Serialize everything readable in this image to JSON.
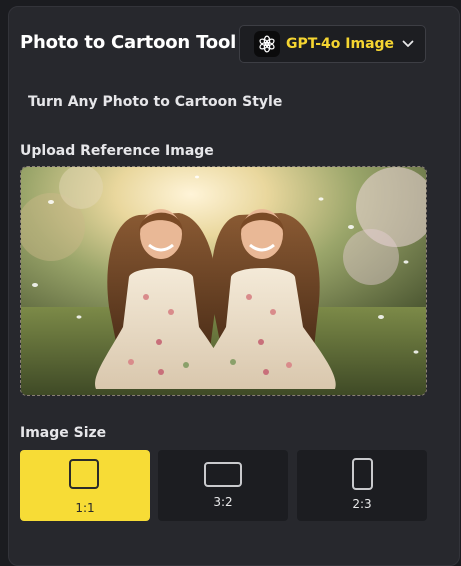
{
  "header": {
    "title": "Photo to Cartoon Tool",
    "model_label": "GPT-4o Image",
    "model_icon": "openai-logo-icon",
    "accent_color": "#f5d531"
  },
  "tool": {
    "subtitle": "Turn Any Photo to Cartoon Style"
  },
  "upload": {
    "label": "Upload Reference Image",
    "image_description": "Photo of two smiling young girls in floral dresses standing outdoors among blossoming trees at sunset"
  },
  "image_size": {
    "label": "Image Size",
    "selected": "1:1",
    "options": [
      {
        "label": "1:1",
        "shape": "square-icon",
        "active": true
      },
      {
        "label": "3:2",
        "shape": "landscape-rect-icon",
        "active": false
      },
      {
        "label": "2:3",
        "shape": "portrait-rect-icon",
        "active": false
      }
    ]
  }
}
